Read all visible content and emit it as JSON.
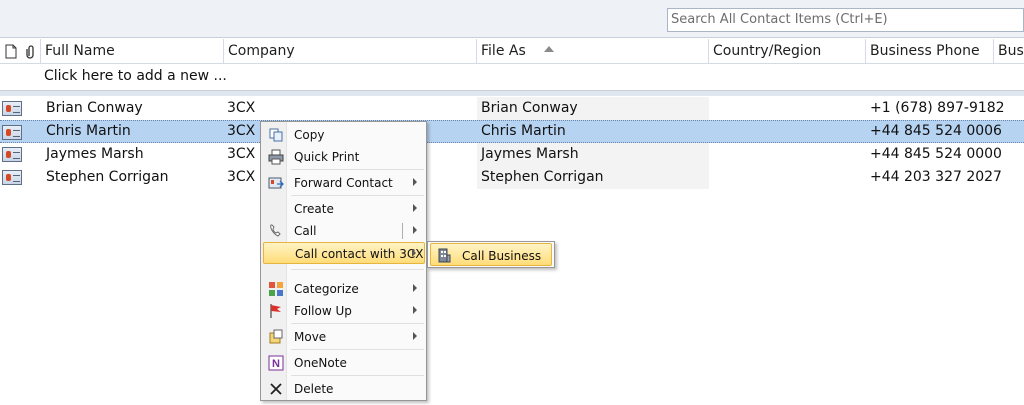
{
  "search": {
    "placeholder": "Search All Contact Items (Ctrl+E)"
  },
  "columns": {
    "full_name": "Full Name",
    "company": "Company",
    "file_as": "File As",
    "country": "Country/Region",
    "business_phone": "Business Phone",
    "business_fax": "Bus"
  },
  "add_new_label": "Click here to add a new ...",
  "contacts": [
    {
      "full_name": "Brian Conway",
      "company": "3CX",
      "file_as": "Brian Conway",
      "business_phone": "+1 (678) 897-9182"
    },
    {
      "full_name": "Chris Martin",
      "company": "3CX",
      "file_as": "Chris Martin",
      "business_phone": "+44 845 524 0006"
    },
    {
      "full_name": "Jaymes Marsh",
      "company": "3CX",
      "file_as": "Jaymes Marsh",
      "business_phone": "+44 845 524 0000"
    },
    {
      "full_name": "Stephen Corrigan",
      "company": "3CX",
      "file_as": "Stephen Corrigan",
      "business_phone": "+44 203 327 2027"
    }
  ],
  "context_menu": {
    "copy": "Copy",
    "quick_print": "Quick Print",
    "forward_contact": "Forward Contact",
    "create": "Create",
    "call": "Call",
    "call_contact_3cx": "Call contact with 3CX",
    "categorize": "Categorize",
    "follow_up": "Follow Up",
    "move": "Move",
    "onenote": "OneNote",
    "delete": "Delete"
  },
  "submenu": {
    "call_business": "Call Business"
  },
  "colors": {
    "selection": "#b7d3f2",
    "highlight": "#ffdc78"
  }
}
